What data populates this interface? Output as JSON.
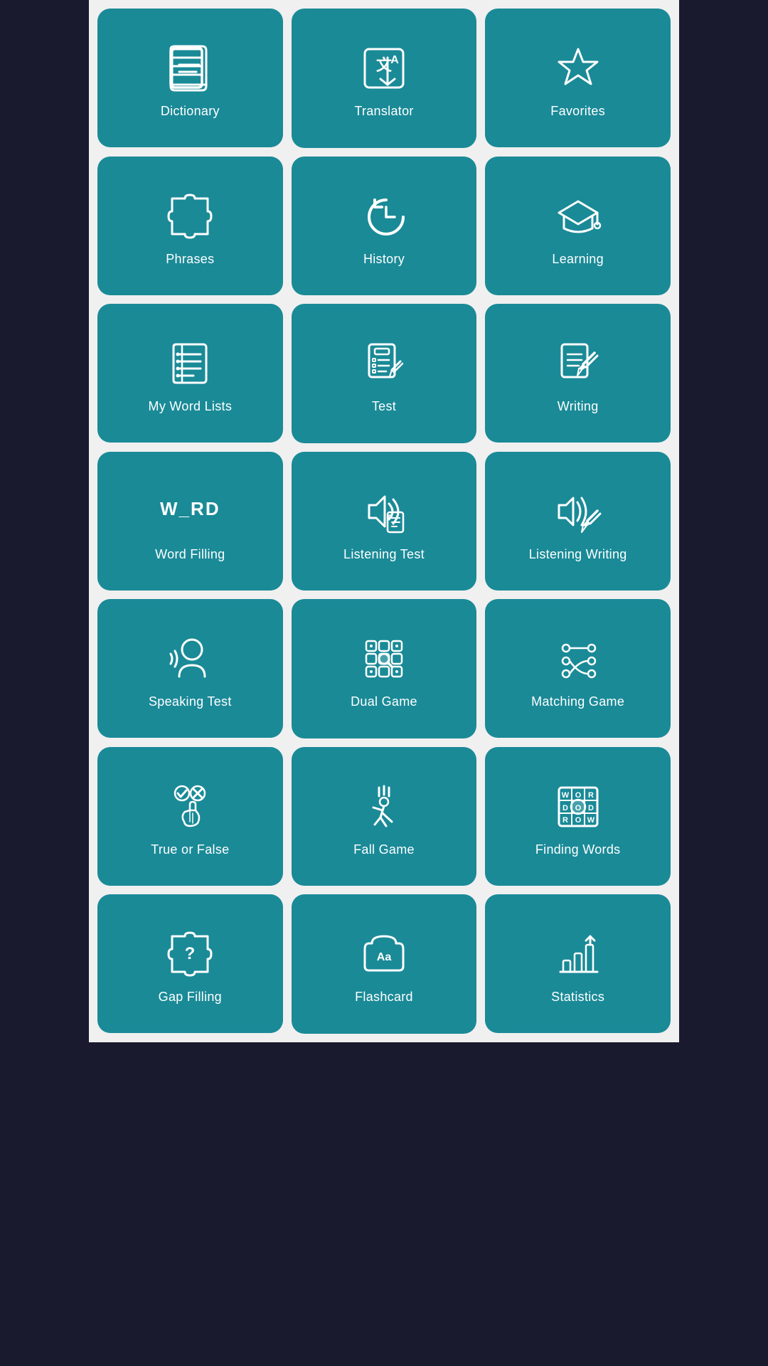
{
  "tiles": [
    {
      "id": "dictionary",
      "label": "Dictionary",
      "icon": "dictionary"
    },
    {
      "id": "translator",
      "label": "Translator",
      "icon": "translator"
    },
    {
      "id": "favorites",
      "label": "Favorites",
      "icon": "favorites"
    },
    {
      "id": "phrases",
      "label": "Phrases",
      "icon": "phrases"
    },
    {
      "id": "history",
      "label": "History",
      "icon": "history"
    },
    {
      "id": "learning",
      "label": "Learning",
      "icon": "learning"
    },
    {
      "id": "my-word-lists",
      "label": "My Word Lists",
      "icon": "wordlists"
    },
    {
      "id": "test",
      "label": "Test",
      "icon": "test"
    },
    {
      "id": "writing",
      "label": "Writing",
      "icon": "writing"
    },
    {
      "id": "word-filling",
      "label": "Word Filling",
      "icon": "wordfilling"
    },
    {
      "id": "listening-test",
      "label": "Listening Test",
      "icon": "listeningtest"
    },
    {
      "id": "listening-writing",
      "label": "Listening Writing",
      "icon": "listeningwriting"
    },
    {
      "id": "speaking-test",
      "label": "Speaking Test",
      "icon": "speakingtest"
    },
    {
      "id": "dual-game",
      "label": "Dual Game",
      "icon": "dualgame"
    },
    {
      "id": "matching-game",
      "label": "Matching Game",
      "icon": "matchinggame"
    },
    {
      "id": "true-or-false",
      "label": "True or False",
      "icon": "trueorfalse"
    },
    {
      "id": "fall-game",
      "label": "Fall Game",
      "icon": "fallgame"
    },
    {
      "id": "finding-words",
      "label": "Finding Words",
      "icon": "findingwords"
    },
    {
      "id": "gap-filling",
      "label": "Gap Filling",
      "icon": "gapfilling"
    },
    {
      "id": "flashcard",
      "label": "Flashcard",
      "icon": "flashcard"
    },
    {
      "id": "statistics",
      "label": "Statistics",
      "icon": "statistics"
    }
  ]
}
